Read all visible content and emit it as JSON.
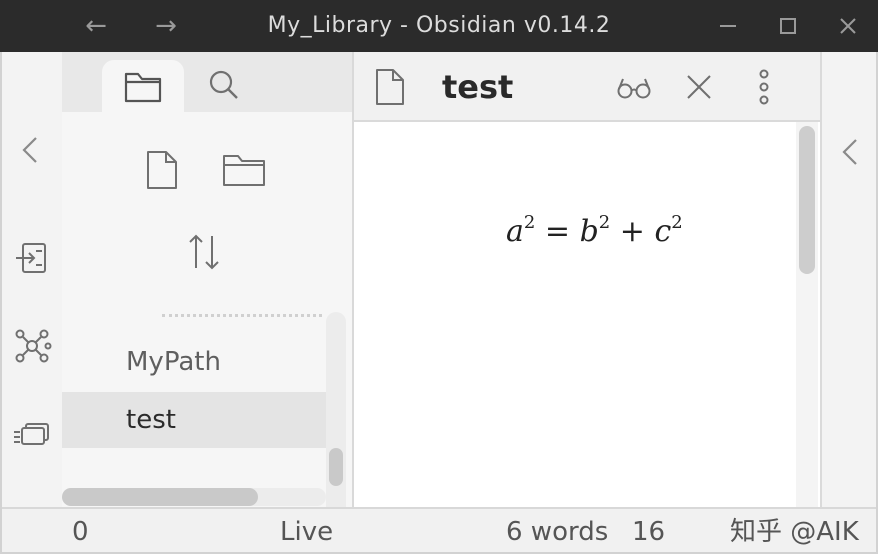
{
  "window": {
    "title": "My_Library - Obsidian v0.14.2",
    "back_icon": "arrow-left-icon",
    "forward_icon": "arrow-right-icon"
  },
  "ribbon": {
    "collapse_icon": "chevron-left-icon",
    "buttons": [
      "import-icon",
      "graph-view-icon",
      "slides-icon"
    ]
  },
  "sidebar": {
    "tabs": [
      {
        "name": "file-explorer",
        "icon": "folder-icon",
        "active": true
      },
      {
        "name": "search",
        "icon": "search-icon",
        "active": false
      }
    ],
    "actions": [
      "new-note-icon",
      "new-folder-icon",
      "sort-icon"
    ],
    "files": [
      {
        "label": "MyPath",
        "active": false
      },
      {
        "label": "test",
        "active": true
      }
    ]
  },
  "editor": {
    "title": "test",
    "buttons": [
      "preview-icon",
      "close-icon",
      "more-options-icon"
    ],
    "math": {
      "a": "a",
      "b": "b",
      "c": "c",
      "exp": "2",
      "eq": "=",
      "plus": "+"
    }
  },
  "right_sidebar": {
    "collapse_icon": "chevron-left-icon"
  },
  "statusbar": {
    "backlinks": "0",
    "mode": "Live",
    "words": "6 words",
    "characters": "16",
    "watermark": "知乎 @AIK"
  },
  "colors": {
    "titlebar_bg": "#2b2b2b",
    "sidebar_bg": "#f6f6f6",
    "ribbon_bg": "#f3f3f3",
    "active_item_bg": "#e4e4e4",
    "editor_bg": "#ffffff"
  }
}
